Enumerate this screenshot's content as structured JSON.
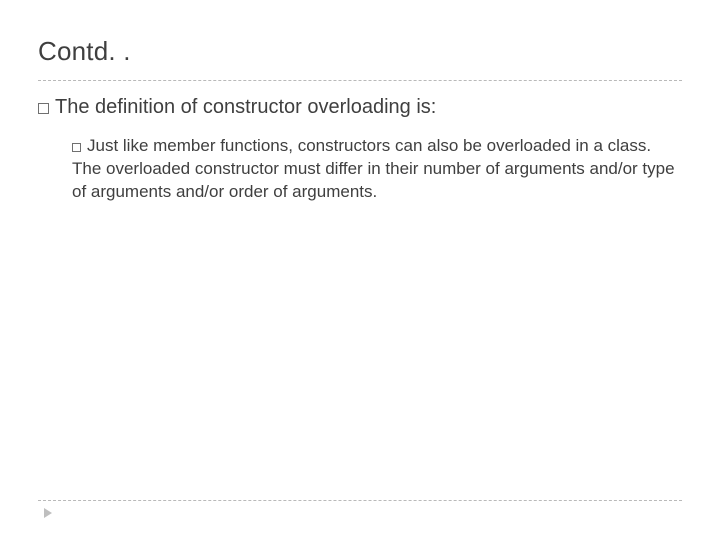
{
  "title": "Contd. .",
  "lvl1_text": "The definition of constructor overloading is:",
  "lvl2_text": "Just like member functions, constructors can also be overloaded in a class. The overloaded constructor must differ in their number of arguments and/or type of arguments and/or order of arguments."
}
